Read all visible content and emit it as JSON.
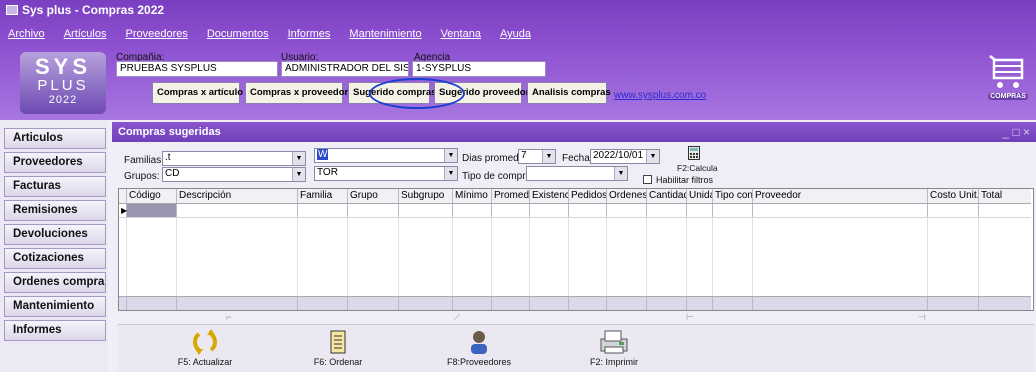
{
  "window": {
    "title": "Sys plus - Compras 2022"
  },
  "menu": [
    "Archivo",
    "Artículos",
    "Proveedores",
    "Documentos",
    "Informes",
    "Mantenimiento",
    "Ventana",
    "Ayuda"
  ],
  "logo": {
    "line1": "SYS",
    "line2": "PLUS",
    "line3": "2022"
  },
  "header": {
    "compania_label": "Compañia:",
    "compania_value": "PRUEBAS SYSPLUS",
    "usuario_label": "Usuario:",
    "usuario_value": "ADMINISTRADOR DEL SISTEM",
    "agencia_label": "Agencia",
    "agencia_value": "1-SYSPLUS"
  },
  "toolbar": [
    "Compras x artículo",
    "Compras x proveedor",
    "Sugerido compras",
    "Sugerido proveedor",
    "Analisis compras"
  ],
  "website": "www.sysplus.com.co",
  "cart_caption": "COMPRAS",
  "sidebar": [
    "Articulos",
    "Proveedores",
    "Facturas",
    "Remisiones",
    "Devoluciones",
    "Cotizaciones",
    "Ordenes compra",
    "Mantenimiento",
    "Informes"
  ],
  "child": {
    "title": "Compras sugeridas",
    "familias_label": "Familias:",
    "familias_value": ".t",
    "grupos_label": "Grupos:",
    "grupos_value": "CD",
    "combo3_value": "W",
    "combo4_value": "TOR",
    "dias_label": "Dias promedio:",
    "dias_value": "7",
    "fecha_label": "Fecha:",
    "fecha_value": "2022/10/01",
    "tipo_label": "Tipo de compra:",
    "tipo_value": "",
    "calc_label": "F2:Calcula",
    "filtros_label": "Habilitar filtros"
  },
  "grid": {
    "columns": [
      "Código",
      "Descripción",
      "Familia",
      "Grupo",
      "Subgrupo",
      "Mínimo",
      "Promedic",
      "Existenci",
      "Pedidos",
      "Ordenes",
      "Cantidad",
      "Unida",
      "Tipo con",
      "Proveedor",
      "Costo Unit.",
      "Total"
    ]
  },
  "footer_ticks": [
    "⌐",
    "⟋",
    "⊢",
    "⊣"
  ],
  "footer_buttons": [
    "F5: Actualizar",
    "F6: Ordenar",
    "F8:Proveedores",
    "F2: Imprimir"
  ],
  "colors": {
    "accent": "#7a3fc0",
    "link": "#2b2bd0",
    "highlight_ring": "#1a3fd0"
  }
}
